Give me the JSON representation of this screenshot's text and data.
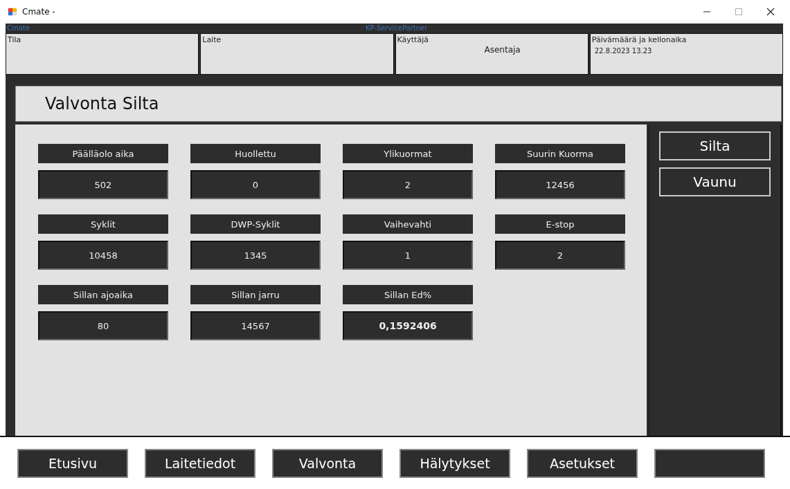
{
  "window": {
    "title": "Cmate -"
  },
  "header_strip": {
    "app_name": "Cmate",
    "company": "KP-ServicePartner"
  },
  "info_boxes": [
    {
      "label": "Tila"
    },
    {
      "label": "Laite"
    },
    {
      "label": "Käyttäjä",
      "value": "Asentaja"
    },
    {
      "label": "Päivämäärä ja kellonaika",
      "value": "22.8.2023 13.23"
    }
  ],
  "page_title": "Valvonta Silta",
  "readings": [
    {
      "label": "Päälläolo aika",
      "value": "502",
      "bold": false
    },
    {
      "label": "Huollettu",
      "value": "0",
      "bold": false
    },
    {
      "label": "Ylikuormat",
      "value": "2",
      "bold": false
    },
    {
      "label": "Suurin Kuorma",
      "value": "12456",
      "bold": false
    },
    {
      "label": "Syklit",
      "value": "10458",
      "bold": false
    },
    {
      "label": "DWP-Syklit",
      "value": "1345",
      "bold": false
    },
    {
      "label": "Vaihevahti",
      "value": "1",
      "bold": false
    },
    {
      "label": "E-stop",
      "value": "2",
      "bold": false
    },
    {
      "label": "Sillan ajoaika",
      "value": "80",
      "bold": false
    },
    {
      "label": "Sillan jarru",
      "value": "14567",
      "bold": false
    },
    {
      "label": "Sillan Ed%",
      "value": "0,1592406",
      "bold": true
    }
  ],
  "side_buttons": [
    "Silta",
    "Vaunu"
  ],
  "nav_buttons": [
    {
      "kind": "text",
      "label": "Etusivu"
    },
    {
      "kind": "text",
      "label": "Laitetiedot"
    },
    {
      "kind": "text",
      "label": "Valvonta"
    },
    {
      "kind": "text",
      "label": "Hälytykset"
    },
    {
      "kind": "text",
      "label": "Asetukset"
    },
    {
      "kind": "blank"
    }
  ]
}
